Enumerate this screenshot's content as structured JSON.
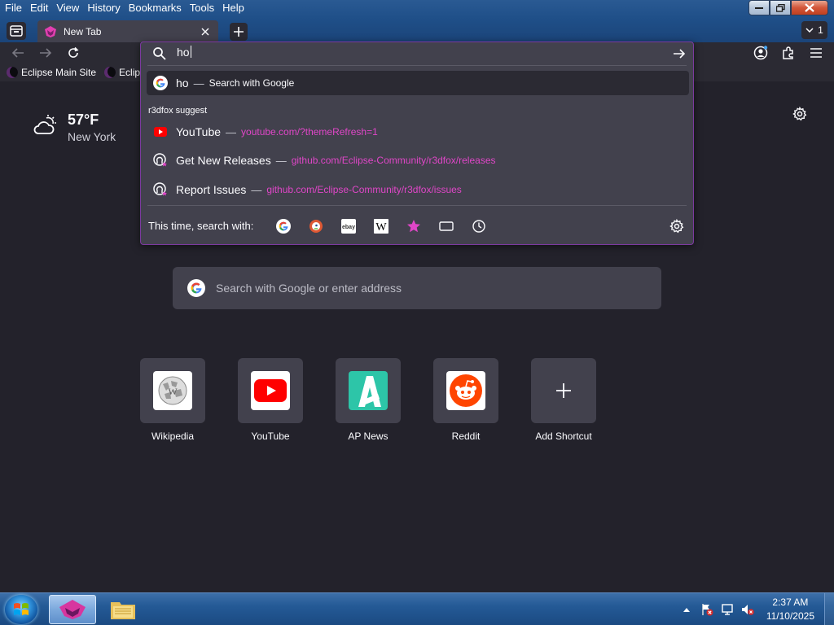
{
  "menu": [
    {
      "key": "F",
      "rest": "ile"
    },
    {
      "key": "E",
      "rest": "dit"
    },
    {
      "key": "V",
      "rest": "iew"
    },
    {
      "key": "",
      "pre": "Hi",
      "key2": "s",
      "rest": "tory"
    },
    {
      "key": "B",
      "rest": "ookmarks"
    },
    {
      "key": "T",
      "rest": "ools"
    },
    {
      "key": "H",
      "rest": "elp"
    }
  ],
  "menu_labels": [
    "File",
    "Edit",
    "View",
    "History",
    "Bookmarks",
    "Tools",
    "Help"
  ],
  "tab": {
    "title": "New Tab"
  },
  "tab_counter": "1",
  "bookmarks": [
    {
      "label": "Eclipse Main Site"
    },
    {
      "label": "Eclips"
    }
  ],
  "urlbar": {
    "value": "ho",
    "first_result": {
      "title": "ho",
      "action": "Search with Google"
    },
    "group_label": "r3dfox suggest",
    "results": [
      {
        "title": "YouTube",
        "url": "youtube.com/?themeRefresh=1",
        "icon": "youtube-icon"
      },
      {
        "title": "Get New Releases",
        "url": "github.com/Eclipse-Community/r3dfox/releases",
        "icon": "github-icon"
      },
      {
        "title": "Report Issues",
        "url": "github.com/Eclipse-Community/r3dfox/issues",
        "icon": "github-icon"
      }
    ],
    "oneoff_label": "This time, search with:",
    "engines": [
      "google-icon",
      "duckduckgo-icon",
      "ebay-icon",
      "wikipedia-icon",
      "bookmarks-star-icon",
      "tabs-icon",
      "history-icon"
    ],
    "dash": "—"
  },
  "weather": {
    "temp": "57°F",
    "city": "New York"
  },
  "search": {
    "placeholder": "Search with Google or enter address"
  },
  "shortcuts": [
    {
      "label": "Wikipedia"
    },
    {
      "label": "YouTube"
    },
    {
      "label": "AP News"
    },
    {
      "label": "Reddit"
    },
    {
      "label": "Add Shortcut"
    }
  ],
  "taskbar": {
    "time": "2:37 AM",
    "date": "11/10/2025"
  },
  "colors": {
    "accent": "#e046c8",
    "panel": "#42414d",
    "bg": "#23222b",
    "border": "#7c3aa0"
  }
}
